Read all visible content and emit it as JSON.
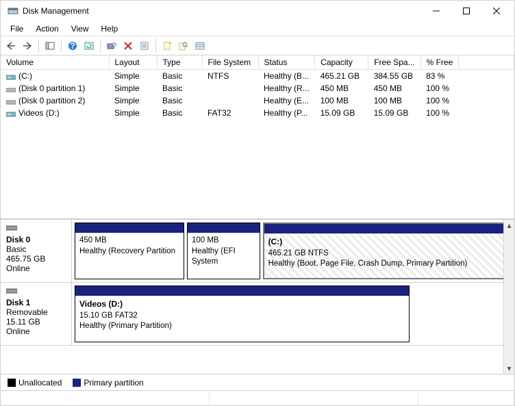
{
  "window": {
    "title": "Disk Management"
  },
  "menu": {
    "items": [
      "File",
      "Action",
      "View",
      "Help"
    ]
  },
  "columns": [
    "Volume",
    "Layout",
    "Type",
    "File System",
    "Status",
    "Capacity",
    "Free Spa...",
    "% Free"
  ],
  "volumes": [
    {
      "icon": "drive",
      "name": "(C:)",
      "layout": "Simple",
      "type": "Basic",
      "fs": "NTFS",
      "status": "Healthy (B...",
      "capacity": "465.21 GB",
      "free": "384.55 GB",
      "pct": "83 %"
    },
    {
      "icon": "part",
      "name": "(Disk 0 partition 1)",
      "layout": "Simple",
      "type": "Basic",
      "fs": "",
      "status": "Healthy (R...",
      "capacity": "450 MB",
      "free": "450 MB",
      "pct": "100 %"
    },
    {
      "icon": "part",
      "name": "(Disk 0 partition 2)",
      "layout": "Simple",
      "type": "Basic",
      "fs": "",
      "status": "Healthy (E...",
      "capacity": "100 MB",
      "free": "100 MB",
      "pct": "100 %"
    },
    {
      "icon": "drive",
      "name": "Videos (D:)",
      "layout": "Simple",
      "type": "Basic",
      "fs": "FAT32",
      "status": "Healthy (P...",
      "capacity": "15.09 GB",
      "free": "15.09 GB",
      "pct": "100 %"
    }
  ],
  "disks": [
    {
      "label": "Disk 0",
      "type": "Basic",
      "size": "465.75 GB",
      "state": "Online",
      "parts": [
        {
          "title": "",
          "line1": "450 MB",
          "line2": "Healthy (Recovery Partition",
          "flex": 18,
          "selected": false
        },
        {
          "title": "",
          "line1": "100 MB",
          "line2": "Healthy (EFI System",
          "flex": 12,
          "selected": false
        },
        {
          "title": "(C:)",
          "line1": "465.21 GB NTFS",
          "line2": "Healthy (Boot, Page File, Crash Dump, Primary Partition)",
          "flex": 40,
          "selected": true
        }
      ]
    },
    {
      "label": "Disk 1",
      "type": "Removable",
      "size": "15.11 GB",
      "state": "Online",
      "parts": [
        {
          "title": "Videos  (D:)",
          "line1": "15.10 GB FAT32",
          "line2": "Healthy (Primary Partition)",
          "flex": 55,
          "selected": false
        }
      ]
    }
  ],
  "legend": {
    "unalloc": "Unallocated",
    "primary": "Primary partition"
  },
  "colors": {
    "primary": "#1a237e",
    "unalloc": "#000000"
  }
}
